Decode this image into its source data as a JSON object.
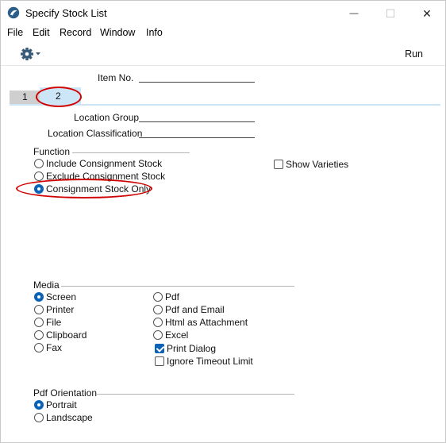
{
  "window": {
    "title": "Specify Stock List",
    "minimize_glyph": "—",
    "maximize_glyph": "☐",
    "close_glyph": "✕"
  },
  "menu": [
    "File",
    "Edit",
    "Record",
    "Window",
    "Info"
  ],
  "toolbar": {
    "run_label": "Run",
    "settings_icon": "gear-icon"
  },
  "fields": {
    "item_no": "Item No.",
    "location_group": "Location Group",
    "location_classification": "Location Classification"
  },
  "tabs": [
    {
      "label": "1",
      "selected": false
    },
    {
      "label": "2",
      "selected": true
    }
  ],
  "function": {
    "title": "Function",
    "options": [
      {
        "label": "Include Consignment Stock",
        "selected": false
      },
      {
        "label": "Exclude Consignment Stock",
        "selected": false
      },
      {
        "label": "Consignment Stock Only",
        "selected": true
      }
    ]
  },
  "show_varieties": {
    "label": "Show Varieties",
    "checked": false
  },
  "media": {
    "title": "Media",
    "options_left": [
      {
        "label": "Screen",
        "selected": true
      },
      {
        "label": "Printer",
        "selected": false
      },
      {
        "label": "File",
        "selected": false
      },
      {
        "label": "Clipboard",
        "selected": false
      },
      {
        "label": "Fax",
        "selected": false
      }
    ],
    "options_right": [
      {
        "label": "Pdf",
        "selected": false
      },
      {
        "label": "Pdf and Email",
        "selected": false
      },
      {
        "label": "Html as Attachment",
        "selected": false
      },
      {
        "label": "Excel",
        "selected": false
      }
    ],
    "print_dialog": {
      "label": "Print Dialog",
      "checked": true
    },
    "ignore_timeout": {
      "label": "Ignore Timeout Limit",
      "checked": false
    }
  },
  "pdf_orientation": {
    "title": "Pdf Orientation",
    "options": [
      {
        "label": "Portrait",
        "selected": true
      },
      {
        "label": "Landscape",
        "selected": false
      }
    ]
  },
  "colors": {
    "accent": "#0a62b8",
    "highlight": "#d10000",
    "tab_selected": "#cde6f7"
  }
}
